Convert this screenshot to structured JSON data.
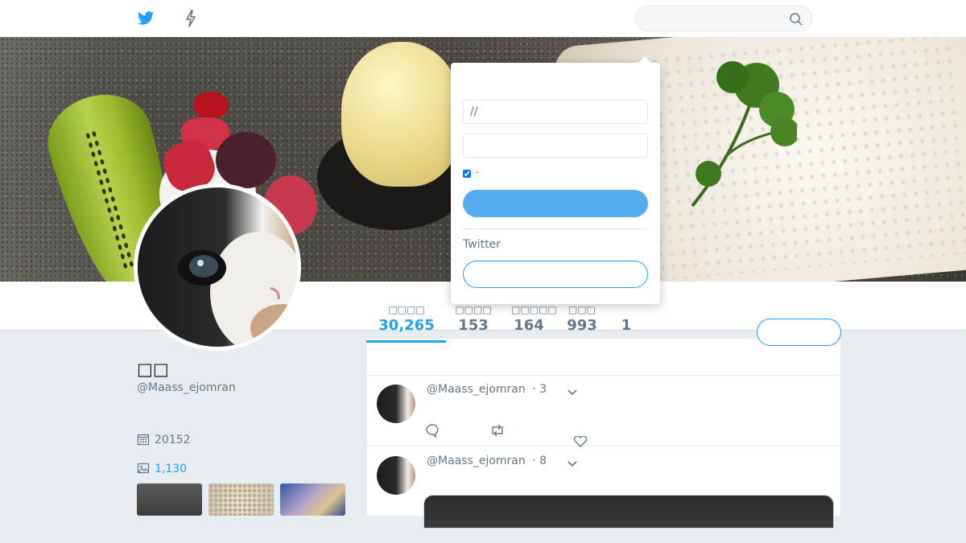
{
  "topbar": {
    "search_placeholder": "",
    "brand_color": "#1da1f2"
  },
  "login": {
    "username_value": "//",
    "password_value": "",
    "remember_label": "·",
    "login_label": "",
    "new_text": "Twitter",
    "signup_label": ""
  },
  "profile": {
    "name": "□□",
    "handle": "@Maass_ejomran",
    "joined": "20152",
    "media_count": "1,130",
    "follow_label": ""
  },
  "stats": [
    {
      "label": "□□□□",
      "value": "30,265"
    },
    {
      "label": "□□□□",
      "value": "153"
    },
    {
      "label": "□□□□□",
      "value": "164"
    },
    {
      "label": "□□□",
      "value": "993"
    },
    {
      "label": "",
      "value": "1"
    }
  ],
  "tweets": [
    {
      "handle": "@Maass_ejomran",
      "time": "· 3"
    },
    {
      "handle": "@Maass_ejomran",
      "time": "· 8"
    }
  ]
}
